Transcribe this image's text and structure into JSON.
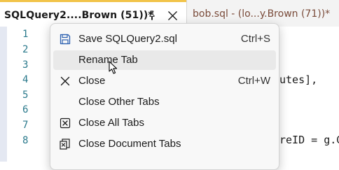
{
  "tabs": [
    {
      "title": "SQLQuery2....Brown (51))*",
      "active": true
    },
    {
      "title": "bob.sql - (lo...y.Brown (71))*",
      "active": false
    }
  ],
  "editor": {
    "line_numbers": [
      "1",
      "2",
      "3",
      "4",
      "5",
      "6",
      "7",
      "8"
    ],
    "visible_code": [
      "utes],",
      "reID = g.G"
    ]
  },
  "context_menu": {
    "items": [
      {
        "label": "Save SQLQuery2.sql",
        "shortcut": "Ctrl+S",
        "icon": "save-icon"
      },
      {
        "label": "Rename Tab",
        "shortcut": "",
        "icon": ""
      },
      {
        "label": "Close",
        "shortcut": "Ctrl+W",
        "icon": "close-icon"
      },
      {
        "label": "Close Other Tabs",
        "shortcut": "",
        "icon": ""
      },
      {
        "label": "Close All Tabs",
        "shortcut": "",
        "icon": "close-all-tabs-icon"
      },
      {
        "label": "Close Document Tabs",
        "shortcut": "",
        "icon": "close-document-tabs-icon"
      }
    ]
  },
  "colors": {
    "active_tab_accent": "#f2c44a",
    "line_number": "#2b7a8c",
    "inactive_tab_text": "#7a4b3a"
  }
}
